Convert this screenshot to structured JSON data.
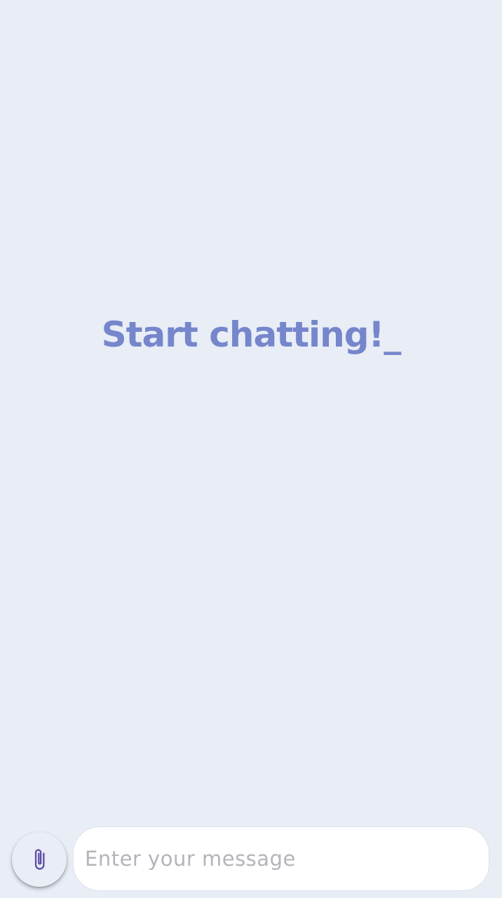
{
  "empty_state": {
    "title": "Start chatting!_"
  },
  "composer": {
    "attach_icon": "paperclip-icon",
    "message_placeholder": "Enter your message",
    "message_value": ""
  },
  "colors": {
    "background": "#e8edf6",
    "accent": "#7686cc",
    "icon": "#5a4aa8"
  }
}
